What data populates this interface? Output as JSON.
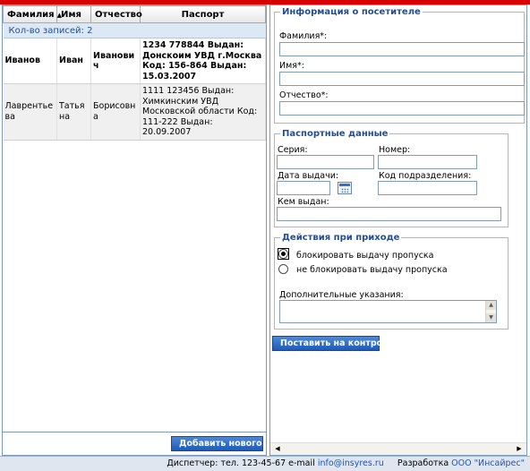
{
  "grid": {
    "columns": [
      "Фамилия",
      "Имя",
      "Отчество",
      "Паспорт"
    ],
    "sort_arrow": "▲",
    "count_text": "Кол-во записей: 2",
    "rows": [
      {
        "lastname": "Иванов",
        "firstname": "Иван",
        "patronymic": "Иванович",
        "passport": "1234 778844 Выдан: Донскоим УВД г.Москва Код: 156-864 Выдан: 15.03.2007"
      },
      {
        "lastname": "Лаврентьева",
        "firstname": "Татьяна",
        "patronymic": "Борисовна",
        "passport": "1111 123456 Выдан: Химкинским УВД Московской области Код: 111-222 Выдан: 20.09.2007"
      }
    ],
    "add_button": "Добавить нового"
  },
  "visitor": {
    "legend": "Информация о посетителе",
    "lastname_label": "Фамилия*:",
    "firstname_label": "Имя*:",
    "patronymic_label": "Отчество*:"
  },
  "passport": {
    "legend": "Паспортные данные",
    "series_label": "Серия:",
    "number_label": "Номер:",
    "issue_date_label": "Дата выдачи:",
    "dept_code_label": "Код подразделения:",
    "issued_by_label": "Кем выдан:"
  },
  "actions": {
    "legend": "Действия при приходе",
    "options": [
      "блокировать выдачу пропуска",
      "не блокировать выдачу пропуска"
    ],
    "selected_index": 0,
    "notes_label": "Дополнительные указания:"
  },
  "submit_button": "Поставить на контроль",
  "footer": {
    "dispatcher_label": "Диспетчер:",
    "phone": "тел. 123-45-67",
    "email_label": "e-mail",
    "email": "info@insyres.ru",
    "dev_label": "Разработка",
    "dev_company": "ООО \"Инсайрес\""
  },
  "colors": {
    "accent": "#1f4e9a",
    "top_bar": "#d90000",
    "button": "#1e5bb5"
  }
}
